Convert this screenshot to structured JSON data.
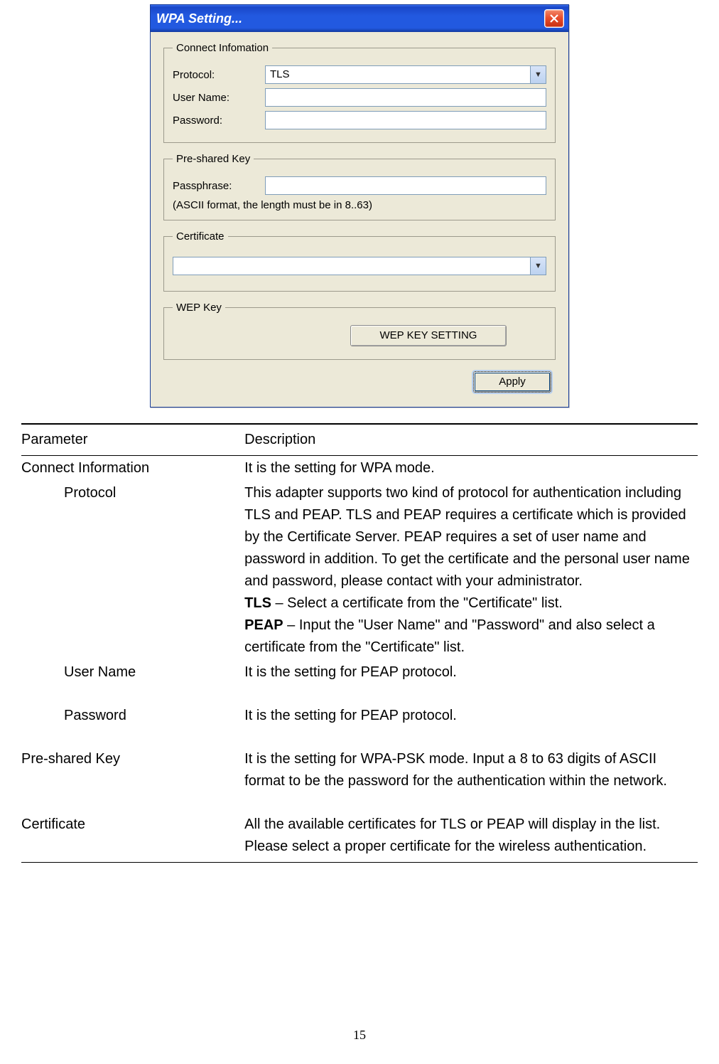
{
  "dialog": {
    "title": "WPA Setting...",
    "group_connect": {
      "legend": "Connect Infomation",
      "protocol_label": "Protocol:",
      "protocol_value": "TLS",
      "user_label": "User Name:",
      "user_value": "",
      "pass_label": "Password:",
      "pass_value": ""
    },
    "group_psk": {
      "legend": "Pre-shared Key",
      "passphrase_label": "Passphrase:",
      "passphrase_value": "",
      "hint": "(ASCII format, the length must be in 8..63)"
    },
    "group_cert": {
      "legend": "Certificate",
      "value": ""
    },
    "group_wep": {
      "legend": "WEP Key",
      "button": "WEP KEY SETTING"
    },
    "apply": "Apply"
  },
  "table": {
    "h1": "Parameter",
    "h2": "Description",
    "rows": {
      "connect_info": {
        "param": "Connect Information",
        "desc": "It is the setting for WPA mode."
      },
      "protocol": {
        "param": "Protocol",
        "desc_main": "This adapter supports two kind of protocol for authentication including TLS and PEAP. TLS and PEAP requires a certificate which is provided by the Certificate Server. PEAP requires a set of user name and password in addition. To get the certificate and the personal user name and password, please contact with your administrator.",
        "tls_bold": "TLS",
        "tls_rest": " – Select a certificate from the \"Certificate\" list.",
        "peap_bold": "PEAP",
        "peap_rest": " – Input the \"User Name\" and \"Password\" and also select a certificate from the \"Certificate\" list."
      },
      "username": {
        "param": "User Name",
        "desc": "It is the setting for PEAP protocol."
      },
      "password": {
        "param": "Password",
        "desc": "It is the setting for PEAP protocol."
      },
      "psk": {
        "param": "Pre-shared Key",
        "desc": "It is the setting for WPA-PSK mode. Input a 8 to 63 digits of ASCII format to be the password for the authentication within the network."
      },
      "cert": {
        "param": "Certificate",
        "desc": "All the available certificates for TLS or PEAP will display in the list. Please select a proper certificate for the wireless authentication."
      }
    }
  },
  "page_number": "15"
}
